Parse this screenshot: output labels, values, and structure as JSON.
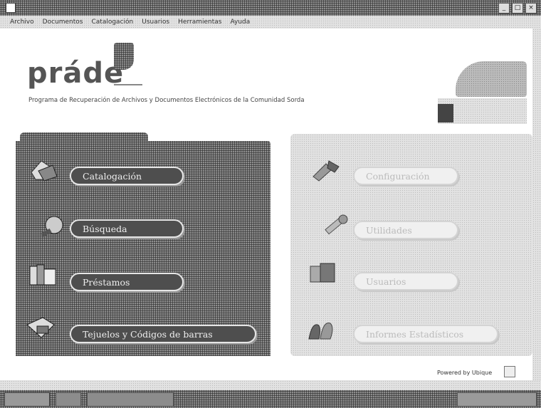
{
  "window": {
    "title": "",
    "controls": [
      "_",
      "□",
      "×"
    ]
  },
  "menu": [
    "Archivo",
    "Documentos",
    "Catalogación",
    "Usuarios",
    "Herramientas",
    "Ayuda"
  ],
  "header": {
    "logo": "práde",
    "subtitle": "Programa de Recuperación de Archivos y Documentos Electrónicos de la Comunidad Sorda"
  },
  "left_panel": {
    "buttons": [
      {
        "label": "Catalogación",
        "icon": "document-stack-icon"
      },
      {
        "label": "Búsqueda",
        "icon": "magnifier-icon"
      },
      {
        "label": "Préstamos",
        "icon": "books-icon"
      },
      {
        "label": "Tejuelos y Códigos de barras",
        "icon": "labels-icon"
      }
    ]
  },
  "right_panel": {
    "buttons": [
      {
        "label": "Configuración",
        "icon": "tools-icon"
      },
      {
        "label": "Utilidades",
        "icon": "wrench-icon"
      },
      {
        "label": "Usuarios",
        "icon": "user-files-icon"
      },
      {
        "label": "Informes Estadísticos",
        "icon": "charts-icon"
      }
    ]
  },
  "footer": {
    "powered": "Powered by Ubique"
  }
}
